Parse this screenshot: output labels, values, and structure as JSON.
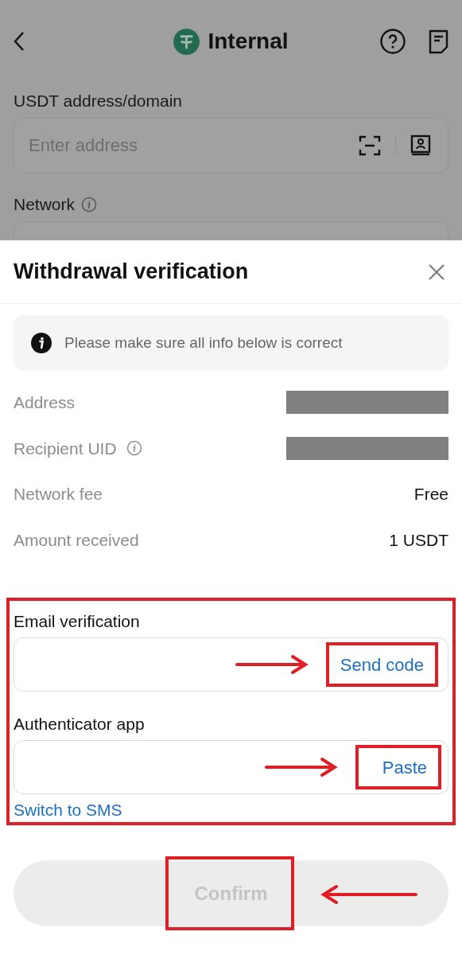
{
  "header": {
    "title": "Internal"
  },
  "address_field": {
    "label": "USDT address/domain",
    "placeholder": "Enter address"
  },
  "network_field": {
    "label": "Network"
  },
  "sheet": {
    "title": "Withdrawal verification",
    "notice": "Please make sure all info below is correct",
    "details": [
      {
        "label": "Address",
        "kind": "redacted",
        "info": false
      },
      {
        "label": "Recipient UID",
        "kind": "redacted",
        "info": true
      },
      {
        "label": "Network fee",
        "kind": "text",
        "value": "Free",
        "info": false
      },
      {
        "label": "Amount received",
        "kind": "text",
        "value": "1 USDT",
        "info": false
      }
    ],
    "verification": [
      {
        "label": "Email verification",
        "action": "Send code"
      },
      {
        "label": "Authenticator app",
        "action": "Paste"
      }
    ],
    "switch_link": "Switch to SMS",
    "confirm": {
      "label": "Confirm",
      "disabled": true
    }
  }
}
